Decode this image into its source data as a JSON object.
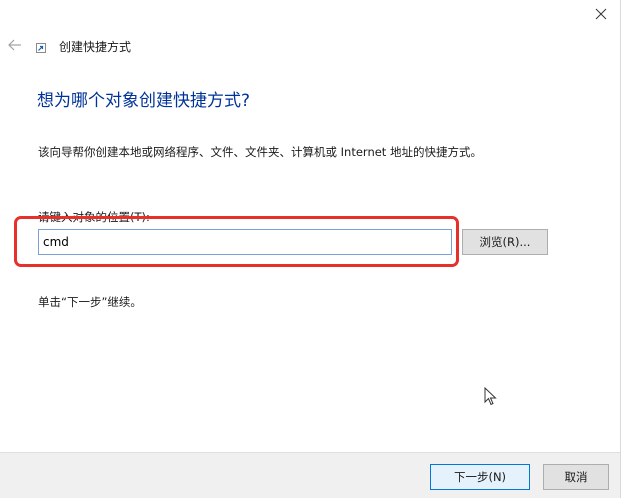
{
  "window": {
    "title": "创建快捷方式",
    "close_icon": "close-icon",
    "back_icon": "back-arrow-icon"
  },
  "main": {
    "heading": "想为哪个对象创建快捷方式?",
    "description": "该向导帮你创建本地或网络程序、文件、文件夹、计算机或 Internet 地址的快捷方式。",
    "location_label": "请键入对象的位置(T):",
    "location_value": "cmd",
    "browse_label": "浏览(R)...",
    "hint": "单击“下一步”继续。"
  },
  "footer": {
    "next_label": "下一步(N)",
    "cancel_label": "取消"
  },
  "colors": {
    "heading": "#003399",
    "highlight": "#e8302a",
    "primary_border": "#0078d7"
  }
}
